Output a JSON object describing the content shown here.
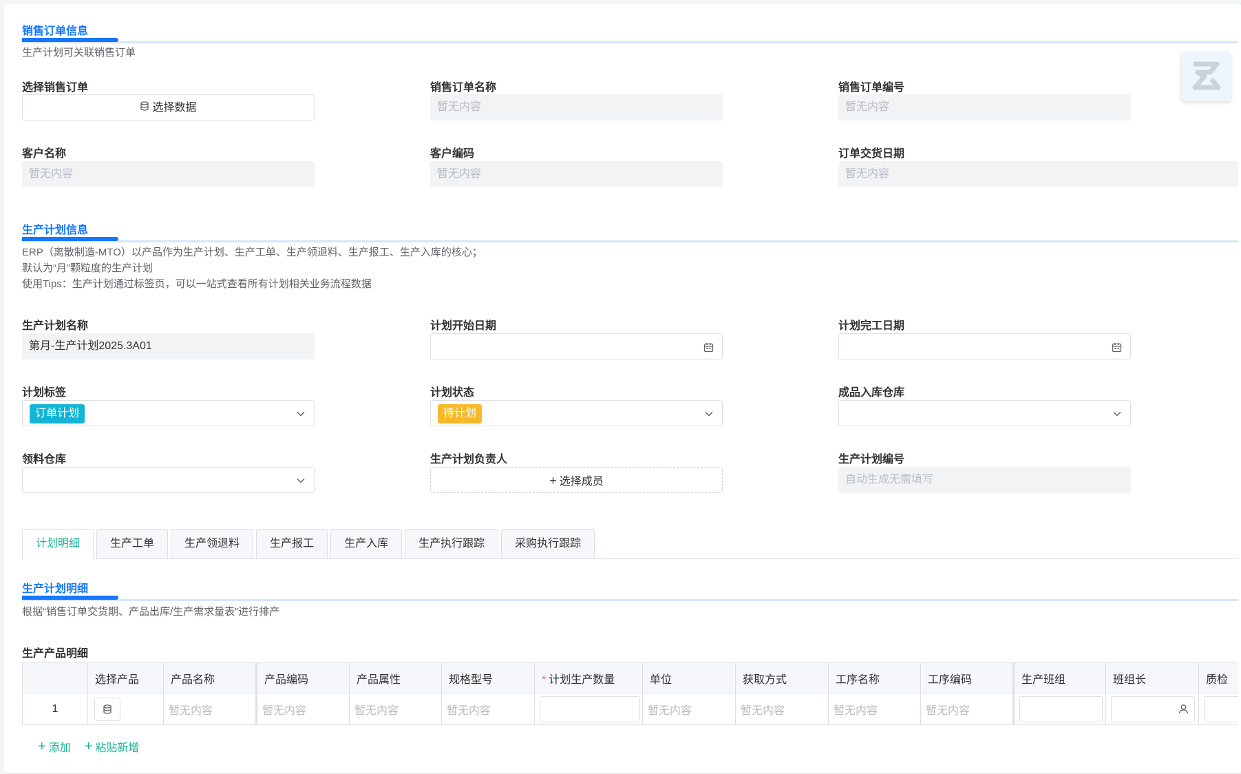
{
  "sales_section": {
    "title": "销售订单信息",
    "description": "生产计划可关联销售订单",
    "fields": {
      "select_order_label": "选择销售订单",
      "select_data_button": "选择数据",
      "order_name_label": "销售订单名称",
      "order_name_value": "暂无内容",
      "order_no_label": "销售订单编号",
      "order_no_value": "暂无内容",
      "customer_name_label": "客户名称",
      "customer_name_value": "暂无内容",
      "customer_code_label": "客户编码",
      "customer_code_value": "暂无内容",
      "delivery_date_label": "订单交货日期",
      "delivery_date_value": "暂无内容"
    }
  },
  "plan_section": {
    "title": "生产计划信息",
    "description_lines": [
      "ERP（离散制造-MTO）以产品作为生产计划、生产工单、生产领退料、生产报工、生产入库的核心；",
      "默认为“月”颗粒度的生产计划",
      "使用Tips：生产计划通过标签页，可以一站式查看所有计划相关业务流程数据"
    ],
    "fields": {
      "plan_name_label": "生产计划名称",
      "plan_name_value": "第月-生产计划2025.3A01",
      "start_date_label": "计划开始日期",
      "start_date_value": "",
      "end_date_label": "计划完工日期",
      "end_date_value": "",
      "tag_label": "计划标签",
      "tag_value": "订单计划",
      "tag_color": "#13b5d6",
      "status_label": "计划状态",
      "status_value": "待计划",
      "status_color": "#f7b928",
      "warehouse_label": "成品入库仓库",
      "warehouse_value": "",
      "material_wh_label": "领料仓库",
      "material_wh_value": "",
      "owner_label": "生产计划负责人",
      "owner_button": "选择成员",
      "plan_no_label": "生产计划编号",
      "plan_no_placeholder": "自动生成无需填写"
    }
  },
  "tabs": [
    "计划明细",
    "生产工单",
    "生产领退料",
    "生产报工",
    "生产入库",
    "生产执行跟踪",
    "采购执行跟踪"
  ],
  "detail_section": {
    "title": "生产计划明细",
    "description": "根据“销售订单交货期、产品出库/生产需求量表”进行排产",
    "table_title": "生产产品明细",
    "columns": [
      "",
      "选择产品",
      "产品名称",
      "产品编码",
      "产品属性",
      "规格型号",
      "计划生产数量",
      "单位",
      "获取方式",
      "工序名称",
      "工序编码",
      "生产班组",
      "班组长",
      "质检"
    ],
    "required_mark": "*",
    "rows": [
      {
        "index": "1",
        "product_name": "暂无内容",
        "product_code": "暂无内容",
        "product_attr": "暂无内容",
        "spec": "暂无内容",
        "unit": "暂无内容",
        "acquire": "暂无内容",
        "process_name": "暂无内容",
        "process_code": "暂无内容"
      }
    ],
    "add_label": "添加",
    "paste_add_label": "粘贴新增"
  },
  "colors": {
    "primary": "#1677ff",
    "accent_green": "#1ab394"
  }
}
